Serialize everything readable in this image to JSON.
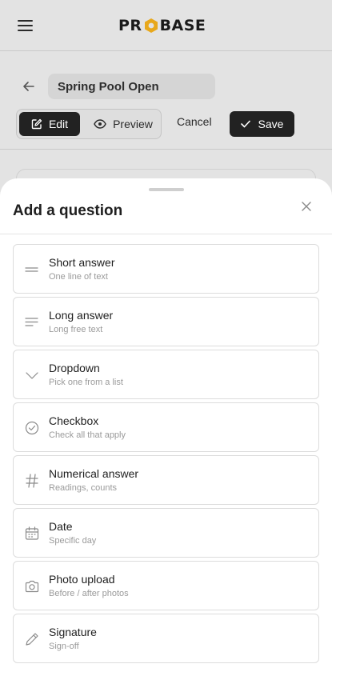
{
  "header": {
    "logo_left": "PR",
    "logo_right": "BASE",
    "menu_icon": "hamburger-icon"
  },
  "editor": {
    "title_value": "Spring Pool Open",
    "edit_label": "Edit",
    "preview_label": "Preview",
    "cancel_label": "Cancel",
    "save_label": "Save"
  },
  "sheet": {
    "title": "Add a question",
    "options": [
      {
        "label": "Short answer",
        "sub": "One line of text",
        "icon": "short-answer-icon"
      },
      {
        "label": "Long answer",
        "sub": "Long free text",
        "icon": "long-answer-icon"
      },
      {
        "label": "Dropdown",
        "sub": "Pick one from a list",
        "icon": "chevron-down-icon"
      },
      {
        "label": "Checkbox",
        "sub": "Check all that apply",
        "icon": "check-circle-icon"
      },
      {
        "label": "Numerical answer",
        "sub": "Readings, counts",
        "icon": "hash-icon"
      },
      {
        "label": "Date",
        "sub": "Specific day",
        "icon": "calendar-icon"
      },
      {
        "label": "Photo upload",
        "sub": "Before / after photos",
        "icon": "camera-icon"
      },
      {
        "label": "Signature",
        "sub": "Sign-off",
        "icon": "pen-icon"
      }
    ]
  },
  "colors": {
    "primary_dark": "#222222",
    "logo_accent": "#e8a81c",
    "overlay_background": "#e3e3e3"
  }
}
